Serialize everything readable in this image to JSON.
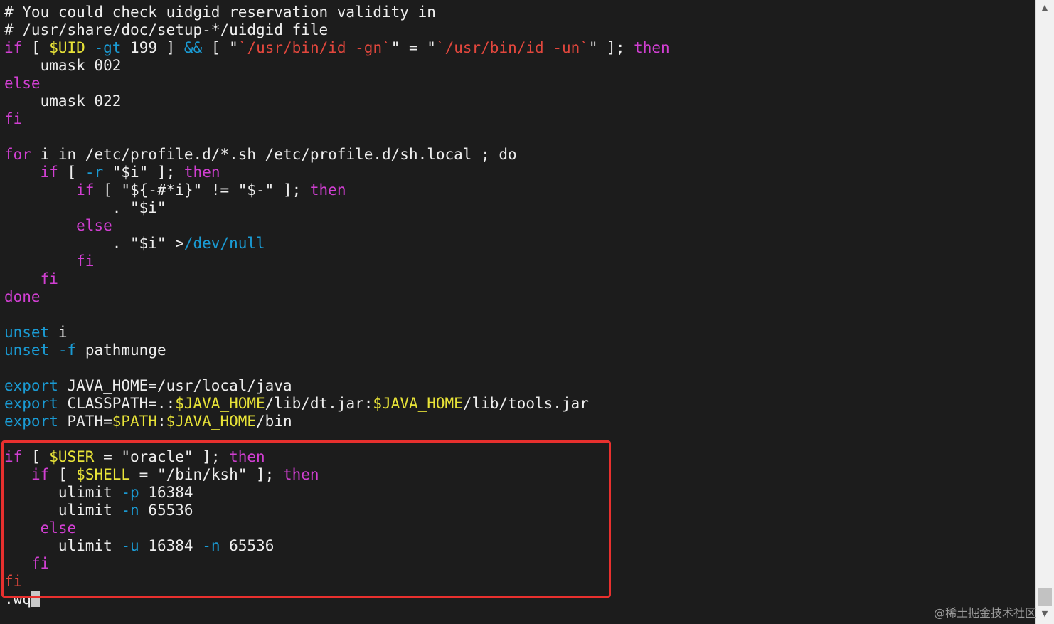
{
  "editor": {
    "lines": [
      [
        {
          "t": "# You could check uidgid reservation validity in",
          "c": "comment"
        }
      ],
      [
        {
          "t": "# /usr/share/doc/setup-*/uidgid file",
          "c": "comment"
        }
      ],
      [
        {
          "t": "if",
          "c": "keyword"
        },
        {
          "t": " [ ",
          "c": "plain"
        },
        {
          "t": "$UID",
          "c": "var"
        },
        {
          "t": " ",
          "c": "plain"
        },
        {
          "t": "-gt",
          "c": "option"
        },
        {
          "t": " 199 ] ",
          "c": "plain"
        },
        {
          "t": "&&",
          "c": "option"
        },
        {
          "t": " [ \"",
          "c": "plain"
        },
        {
          "t": "`/usr/bin/id -gn`",
          "c": "string"
        },
        {
          "t": "\" = \"",
          "c": "plain"
        },
        {
          "t": "`/usr/bin/id -un`",
          "c": "string"
        },
        {
          "t": "\" ]; ",
          "c": "plain"
        },
        {
          "t": "then",
          "c": "keyword"
        }
      ],
      [
        {
          "t": "    umask 002",
          "c": "plain"
        }
      ],
      [
        {
          "t": "else",
          "c": "keyword"
        }
      ],
      [
        {
          "t": "    umask 022",
          "c": "plain"
        }
      ],
      [
        {
          "t": "fi",
          "c": "keyword"
        }
      ],
      [],
      [
        {
          "t": "for",
          "c": "keyword"
        },
        {
          "t": " i in /etc/profile.d/*.sh /etc/profile.d/sh.local ; do",
          "c": "plain"
        }
      ],
      [
        {
          "t": "    ",
          "c": "plain"
        },
        {
          "t": "if",
          "c": "keyword"
        },
        {
          "t": " [ ",
          "c": "plain"
        },
        {
          "t": "-r",
          "c": "option"
        },
        {
          "t": " \"$i\" ]; ",
          "c": "plain"
        },
        {
          "t": "then",
          "c": "keyword"
        }
      ],
      [
        {
          "t": "        ",
          "c": "plain"
        },
        {
          "t": "if",
          "c": "keyword"
        },
        {
          "t": " [ \"${-#*i}\" != \"$-\" ]; ",
          "c": "plain"
        },
        {
          "t": "then",
          "c": "keyword"
        }
      ],
      [
        {
          "t": "            . \"$i\"",
          "c": "plain"
        }
      ],
      [
        {
          "t": "        ",
          "c": "plain"
        },
        {
          "t": "else",
          "c": "keyword"
        }
      ],
      [
        {
          "t": "            . \"$i\" >",
          "c": "plain"
        },
        {
          "t": "/dev/null",
          "c": "option"
        }
      ],
      [
        {
          "t": "        ",
          "c": "plain"
        },
        {
          "t": "fi",
          "c": "keyword"
        }
      ],
      [
        {
          "t": "    ",
          "c": "plain"
        },
        {
          "t": "fi",
          "c": "keyword"
        }
      ],
      [
        {
          "t": "done",
          "c": "keyword"
        }
      ],
      [],
      [
        {
          "t": "unset",
          "c": "option"
        },
        {
          "t": " i",
          "c": "plain"
        }
      ],
      [
        {
          "t": "unset",
          "c": "option"
        },
        {
          "t": " ",
          "c": "plain"
        },
        {
          "t": "-f",
          "c": "option"
        },
        {
          "t": " pathmunge",
          "c": "plain"
        }
      ],
      [],
      [
        {
          "t": "export",
          "c": "option"
        },
        {
          "t": " JAVA_HOME=/usr/local/java",
          "c": "plain"
        }
      ],
      [
        {
          "t": "export",
          "c": "option"
        },
        {
          "t": " CLASSPATH=.:",
          "c": "plain"
        },
        {
          "t": "$JAVA_HOME",
          "c": "var"
        },
        {
          "t": "/lib/dt.jar:",
          "c": "plain"
        },
        {
          "t": "$JAVA_HOME",
          "c": "var"
        },
        {
          "t": "/lib/tools.jar",
          "c": "plain"
        }
      ],
      [
        {
          "t": "export",
          "c": "option"
        },
        {
          "t": " PATH=",
          "c": "plain"
        },
        {
          "t": "$PATH",
          "c": "var"
        },
        {
          "t": ":",
          "c": "plain"
        },
        {
          "t": "$JAVA_HOME",
          "c": "var"
        },
        {
          "t": "/bin",
          "c": "plain"
        }
      ],
      [],
      [
        {
          "t": "if",
          "c": "keyword"
        },
        {
          "t": " [ ",
          "c": "plain"
        },
        {
          "t": "$USER",
          "c": "var"
        },
        {
          "t": " = \"oracle\" ]; ",
          "c": "plain"
        },
        {
          "t": "then",
          "c": "keyword"
        }
      ],
      [
        {
          "t": "   ",
          "c": "plain"
        },
        {
          "t": "if",
          "c": "keyword"
        },
        {
          "t": " [ ",
          "c": "plain"
        },
        {
          "t": "$SHELL",
          "c": "var"
        },
        {
          "t": " = \"/bin/ksh\" ]; ",
          "c": "plain"
        },
        {
          "t": "then",
          "c": "keyword"
        }
      ],
      [
        {
          "t": "      ulimit ",
          "c": "plain"
        },
        {
          "t": "-p",
          "c": "option"
        },
        {
          "t": " 16384",
          "c": "plain"
        }
      ],
      [
        {
          "t": "      ulimit ",
          "c": "plain"
        },
        {
          "t": "-n",
          "c": "option"
        },
        {
          "t": " 65536",
          "c": "plain"
        }
      ],
      [
        {
          "t": "    ",
          "c": "plain"
        },
        {
          "t": "else",
          "c": "keyword"
        }
      ],
      [
        {
          "t": "      ulimit ",
          "c": "plain"
        },
        {
          "t": "-u",
          "c": "option"
        },
        {
          "t": " 16384 ",
          "c": "plain"
        },
        {
          "t": "-n",
          "c": "option"
        },
        {
          "t": " 65536",
          "c": "plain"
        }
      ],
      [
        {
          "t": "   ",
          "c": "plain"
        },
        {
          "t": "fi",
          "c": "keyword"
        }
      ],
      [
        {
          "t": "fi",
          "c": "string"
        }
      ]
    ],
    "command_line": ":wq",
    "colors": {
      "background": "#1c1c1c",
      "keyword": "#d13fd2",
      "variable": "#e8e338",
      "string": "#e2473d",
      "option": "#1a9bd4",
      "text": "#eeeeee",
      "highlight_box": "#e8302e"
    }
  },
  "scrollbar": {
    "up_arrow_icon": "chevron-up-icon",
    "down_arrow_icon": "chevron-down-icon",
    "scroll_position": 0.96
  },
  "watermark": {
    "text": "@稀土掘金技术社区"
  }
}
